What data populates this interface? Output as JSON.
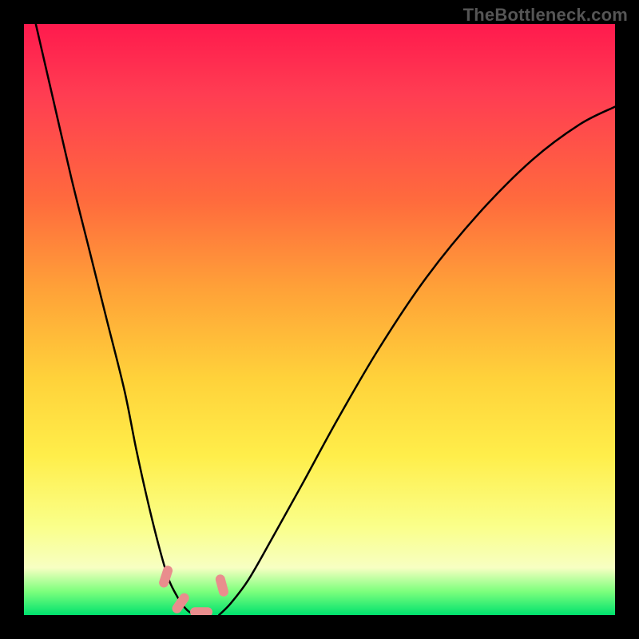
{
  "watermark": "TheBottleneck.com",
  "chart_data": {
    "type": "line",
    "title": "",
    "xlabel": "",
    "ylabel": "",
    "xlim": [
      0,
      100
    ],
    "ylim": [
      0,
      100
    ],
    "grid": false,
    "legend": false,
    "series": [
      {
        "name": "left-curve",
        "x": [
          2,
          5,
          8,
          11,
          14,
          17,
          19,
          21,
          23,
          24.5,
          26,
          27,
          28,
          29
        ],
        "y": [
          100,
          87,
          74,
          62,
          50,
          38,
          28,
          19,
          11,
          6,
          3,
          1.5,
          0.5,
          0
        ]
      },
      {
        "name": "right-curve",
        "x": [
          33,
          35,
          38,
          42,
          47,
          53,
          60,
          68,
          77,
          86,
          94,
          100
        ],
        "y": [
          0,
          2,
          6,
          13,
          22,
          33,
          45,
          57,
          68,
          77,
          83,
          86
        ]
      }
    ],
    "markers": [
      {
        "name": "left-marker-upper",
        "cx": 24.0,
        "cy": 6.5,
        "angle": -72
      },
      {
        "name": "left-marker-lower",
        "cx": 26.5,
        "cy": 2.0,
        "angle": -55
      },
      {
        "name": "right-marker-upper",
        "cx": 33.5,
        "cy": 5.0,
        "angle": 75
      },
      {
        "name": "bottom-marker",
        "cx": 30.0,
        "cy": 0.5,
        "angle": 0
      }
    ],
    "background_gradient": {
      "top": "#ff1a4d",
      "mid_upper": "#ff6b3d",
      "mid": "#ffd23a",
      "mid_lower": "#faff8a",
      "bottom": "#00e26e"
    }
  }
}
